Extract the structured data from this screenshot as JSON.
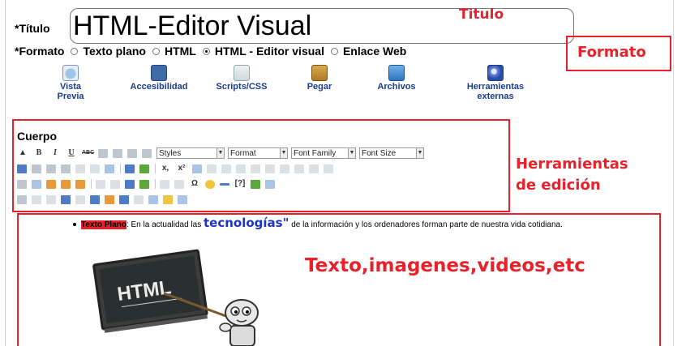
{
  "title_field": {
    "required_mark": "*",
    "label": "Título",
    "value": "HTML-Editor Visual"
  },
  "format_field": {
    "required_mark": "*",
    "label": "Formato",
    "options": [
      {
        "label": "Texto plano",
        "selected": false
      },
      {
        "label": "HTML",
        "selected": false
      },
      {
        "label": "HTML - Editor visual",
        "selected": true
      },
      {
        "label": "Enlace Web",
        "selected": false
      }
    ]
  },
  "big_toolbar": [
    {
      "label": "Vista Previa",
      "icon": "preview-icon"
    },
    {
      "label": "Accesibilidad",
      "icon": "accessibility-icon"
    },
    {
      "label": "Scripts/CSS",
      "icon": "scripts-icon"
    },
    {
      "label": "Pegar",
      "icon": "paste-icon"
    },
    {
      "label": "Archivos",
      "icon": "files-icon"
    },
    {
      "label": "Herramientas externas",
      "icon": "external-tools-icon"
    }
  ],
  "body_label": "Cuerpo",
  "editor_toolbar": {
    "selects": [
      "Styles",
      "Format",
      "Font Family",
      "Font Size"
    ]
  },
  "content": {
    "highlight": "Texto Plano",
    "text_before": ": En la actualidad las ",
    "big_word": "tecnologías\"",
    "text_after": " de la información y los ordenadores forman parte de nuestra vida cotidiana.",
    "image_text": "HTML"
  },
  "annotations": {
    "titulo": "Titulo",
    "formato": "Formato",
    "herramientas_line1": "Herramientas",
    "herramientas_line2": "de edición",
    "contenido": "Texto,imagenes,videos,etc"
  },
  "colors": {
    "annotation_red": "#e8212b",
    "link_blue": "#1b35c8",
    "label_blue": "#1a3d8f"
  }
}
